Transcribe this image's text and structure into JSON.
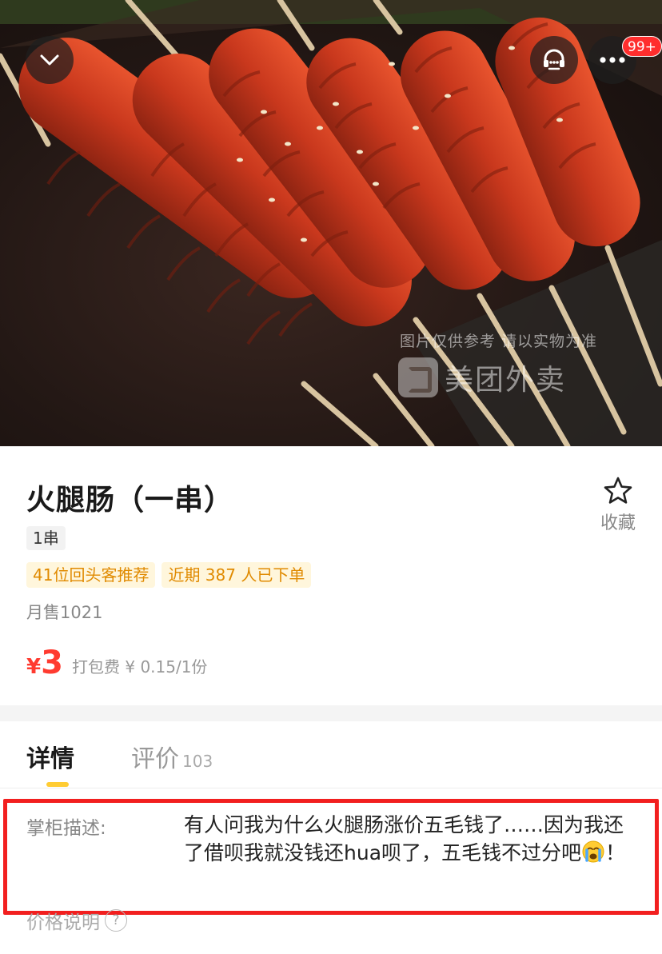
{
  "header": {
    "back_icon": "chevron-down-icon",
    "service_icon": "customer-service-icon",
    "more_icon": "more-icon",
    "badge": "99+",
    "watermark_line1": "图片仅供参考 请以实物为准",
    "watermark_brand": "美团外卖"
  },
  "product": {
    "title": "火腿肠（一串）",
    "favorite_label": "收藏",
    "spec": "1串",
    "tags": [
      "41位回头客推荐",
      "近期 387 人已下单"
    ],
    "monthly_sales": "月售1021",
    "price_currency": "¥",
    "price_value": "3",
    "packing_fee": "打包费 ¥ 0.15/1份"
  },
  "tabs": {
    "detail": "详情",
    "review": "评价",
    "review_count": "103"
  },
  "description": {
    "label": "掌柜描述:",
    "text_before_emoji": "有人问我为什么火腿肠涨价五毛钱了……因为我还了借呗我就没钱还hua呗了，五毛钱不过分吧",
    "text_after_emoji": "！",
    "price_note_label": "价格说明",
    "price_note_icon": "question-icon"
  },
  "colors": {
    "price": "#ff3b30",
    "tag_text": "#e08a00",
    "tag_bg": "#fff6dc",
    "highlight_border": "#f21f1f",
    "tab_indicator": "#ffcc33",
    "badge": "#ff2d2d"
  }
}
